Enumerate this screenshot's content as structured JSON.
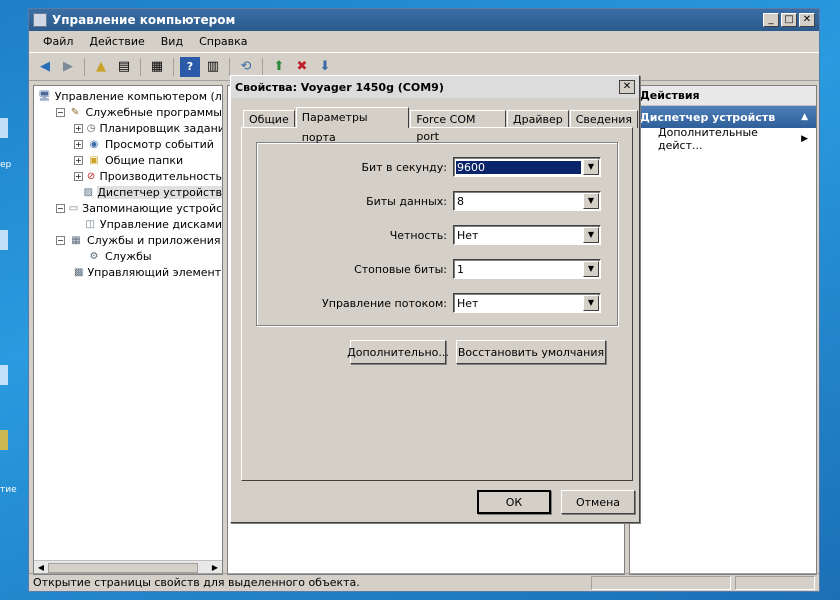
{
  "desktop": {
    "labels": [
      "ер",
      "тие"
    ]
  },
  "window": {
    "title": "Управление компьютером",
    "controls": {
      "minimize": "_",
      "maximize": "□",
      "close": "✕"
    }
  },
  "menu": [
    "Файл",
    "Действие",
    "Вид",
    "Справка"
  ],
  "tree": {
    "items": [
      {
        "label": "Управление компьютером (лока",
        "icon": "computer-icon",
        "expander": "",
        "indent": 0
      },
      {
        "label": "Служебные программы",
        "icon": "tools-icon",
        "expander": "−",
        "indent": 1
      },
      {
        "label": "Планировщик заданий",
        "icon": "clock-icon",
        "expander": "+",
        "indent": 2
      },
      {
        "label": "Просмотр событий",
        "icon": "event-viewer-icon",
        "expander": "+",
        "indent": 2
      },
      {
        "label": "Общие папки",
        "icon": "shared-folder-icon",
        "expander": "+",
        "indent": 2
      },
      {
        "label": "Производительность",
        "icon": "performance-icon",
        "expander": "+",
        "indent": 2
      },
      {
        "label": "Диспетчер устройств",
        "icon": "device-manager-icon",
        "expander": "",
        "indent": 2
      },
      {
        "label": "Запоминающие устройства",
        "icon": "storage-icon",
        "expander": "−",
        "indent": 1
      },
      {
        "label": "Управление дисками",
        "icon": "disk-icon",
        "expander": "",
        "indent": 2
      },
      {
        "label": "Службы и приложения",
        "icon": "services-apps-icon",
        "expander": "−",
        "indent": 1
      },
      {
        "label": "Службы",
        "icon": "services-icon",
        "expander": "",
        "indent": 2
      },
      {
        "label": "Управляющий элемент V",
        "icon": "wmi-icon",
        "expander": "",
        "indent": 2
      }
    ],
    "selected_index": 6
  },
  "actions": {
    "header": "Действия",
    "section": "Диспетчер устройств",
    "items": [
      "Дополнительные дейст..."
    ]
  },
  "status": {
    "text": "Открытие страницы свойств для выделенного объекта."
  },
  "dialog": {
    "title": "Свойства: Voyager 1450g (COM9)",
    "close": "✕",
    "tabs": [
      "Общие",
      "Параметры порта",
      "Force COM port",
      "Драйвер",
      "Сведения"
    ],
    "active_tab": 1,
    "fields": [
      {
        "label": "Бит в секунду:",
        "value": "9600"
      },
      {
        "label": "Биты данных:",
        "value": "8"
      },
      {
        "label": "Четность:",
        "value": "Нет"
      },
      {
        "label": "Стоповые биты:",
        "value": "1"
      },
      {
        "label": "Управление потоком:",
        "value": "Нет"
      }
    ],
    "buttons": {
      "advanced": "Дополнительно...",
      "restore": "Восстановить умолчания",
      "ok": "ОК",
      "cancel": "Отмена"
    }
  }
}
